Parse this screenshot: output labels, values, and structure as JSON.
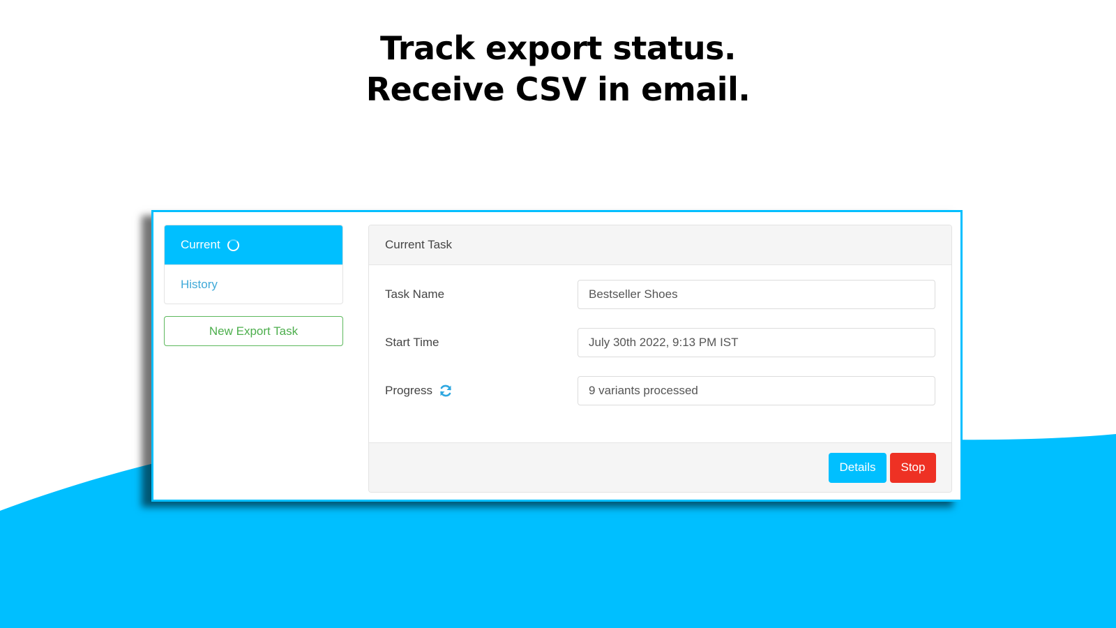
{
  "headline": {
    "line1": "Track export status.",
    "line2": "Receive CSV in email."
  },
  "colors": {
    "accent": "#00bfff",
    "success": "#5cb85c",
    "danger": "#ee3124",
    "background_wave": "#00bfff"
  },
  "sidebar": {
    "items": [
      {
        "label": "Current",
        "icon": "spinner-icon",
        "active": true
      },
      {
        "label": "History",
        "active": false
      }
    ],
    "new_task_label": "New Export Task"
  },
  "panel": {
    "title": "Current Task",
    "fields": [
      {
        "label": "Task Name",
        "value": "Bestseller Shoes"
      },
      {
        "label": "Start Time",
        "value": "July 30th 2022, 9:13 PM IST"
      },
      {
        "label": "Progress",
        "icon": "refresh-icon",
        "value": "9 variants processed"
      }
    ],
    "buttons": {
      "details": "Details",
      "stop": "Stop"
    }
  }
}
